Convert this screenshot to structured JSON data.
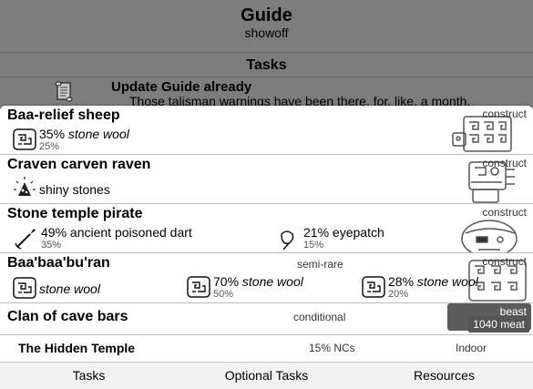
{
  "header": {
    "title": "Guide",
    "subtitle": "showoff"
  },
  "tasks": {
    "heading": "Tasks",
    "items": [
      {
        "icon": "scroll-icon",
        "title": "Update Guide already",
        "description": "Those talisman warnings have been there, for, like, a month."
      }
    ]
  },
  "monsters": [
    {
      "name": "Baa-relief sheep",
      "type": "construct",
      "note": "",
      "art": "sheep-art",
      "drops": [
        {
          "icon": "stone-wool-icon",
          "pct": "35%",
          "item": "stone wool",
          "italic": true,
          "rate": "25%"
        }
      ]
    },
    {
      "name": "Craven carven raven",
      "type": "construct",
      "note": "",
      "art": "raven-art",
      "drops": [
        {
          "icon": "shiny-stones-icon",
          "pct": "",
          "item": "shiny stones",
          "italic": false,
          "rate": ""
        }
      ]
    },
    {
      "name": "Stone temple pirate",
      "type": "construct",
      "note": "",
      "art": "pirate-art",
      "drops": [
        {
          "icon": "poisoned-dart-icon",
          "pct": "49%",
          "item": "ancient poisoned dart",
          "italic": false,
          "rate": "35%"
        },
        {
          "icon": "eyepatch-icon",
          "pct": "21%",
          "item": "eyepatch",
          "italic": false,
          "rate": "15%"
        }
      ]
    },
    {
      "name": "Baa'baa'bu'ran",
      "type": "construct",
      "note": "semi-rare",
      "art": "baabaaburan-art",
      "drops": [
        {
          "icon": "stone-wool-icon",
          "pct": "",
          "item": "stone wool",
          "italic": true,
          "rate": ""
        },
        {
          "icon": "stone-wool-icon",
          "pct": "70%",
          "item": "stone wool",
          "italic": true,
          "rate": "50%"
        },
        {
          "icon": "stone-wool-icon",
          "pct": "28%",
          "item": "stone wool",
          "italic": true,
          "rate": "20%"
        }
      ]
    },
    {
      "name": "Clan of cave bars",
      "type": "beast",
      "note": "conditional",
      "art": "cave-bars-art",
      "meat": "1040 meat",
      "drops": []
    }
  ],
  "location": {
    "name": "The Hidden Temple",
    "nc_rate": "15% NCs",
    "environment": "Indoor"
  },
  "tabbar": {
    "tabs": [
      "Tasks",
      "Optional Tasks",
      "Resources"
    ]
  },
  "colors": {
    "header_bg": "#7d7d7d",
    "panel_bg": "#ffffff",
    "divider": "#bdbdbd",
    "tabbar_bg": "#f2f2f2"
  }
}
